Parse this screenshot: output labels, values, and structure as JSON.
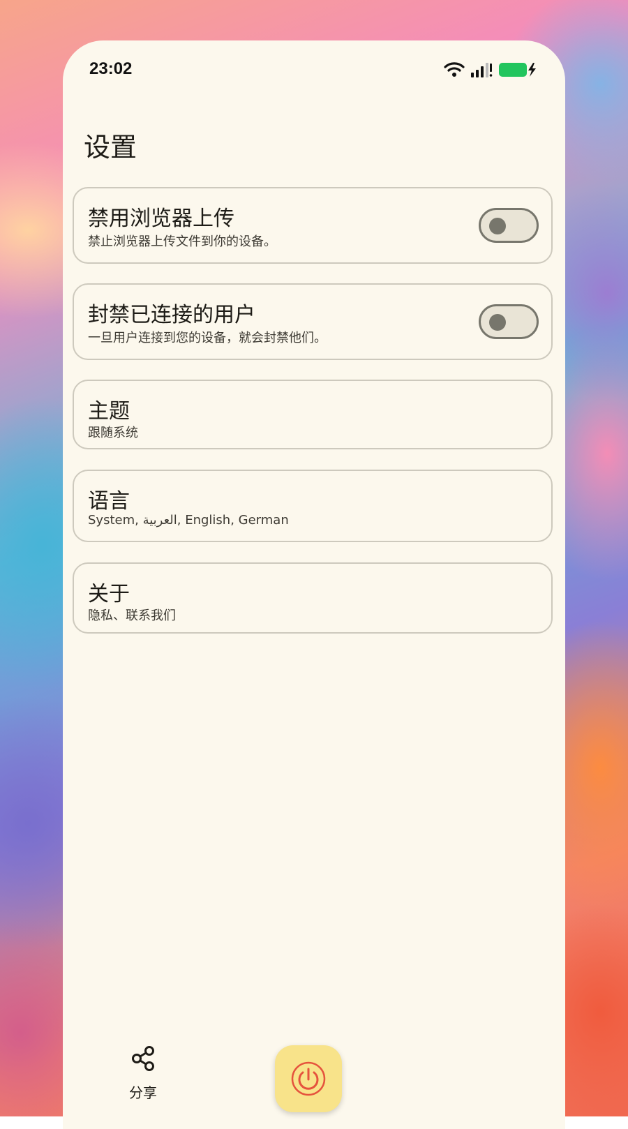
{
  "status_bar": {
    "time": "23:02",
    "icons": [
      "wifi-icon",
      "signal-icon",
      "battery-charging-icon"
    ],
    "battery_color": "#22c55e"
  },
  "header": {
    "title": "设置"
  },
  "settings": [
    {
      "key": "disable-browser-upload",
      "title": "禁用浏览器上传",
      "subtitle": "禁止浏览器上传文件到你的设备。",
      "has_toggle": true,
      "toggle_on": false
    },
    {
      "key": "block-connected-users",
      "title": "封禁已连接的用户",
      "subtitle": "一旦用户连接到您的设备，就会封禁他们。",
      "has_toggle": true,
      "toggle_on": false
    },
    {
      "key": "theme",
      "title": "主题",
      "subtitle": "跟随系统",
      "has_toggle": false
    },
    {
      "key": "language",
      "title": "语言",
      "subtitle": "System, العربية, English, German",
      "has_toggle": false
    },
    {
      "key": "about",
      "title": "关于",
      "subtitle": "隐私、联系我们",
      "has_toggle": false
    }
  ],
  "bottom_nav": {
    "share_label": "分享",
    "share_icon": "share-icon",
    "power_icon": "power-icon",
    "power_button_color": "#f8e38a",
    "power_icon_color": "#e5533d"
  },
  "colors": {
    "surface": "#fcf8ed",
    "card_border": "#cdc9bd",
    "switch_track": "#e9e4d6",
    "switch_outline": "#77766c"
  }
}
